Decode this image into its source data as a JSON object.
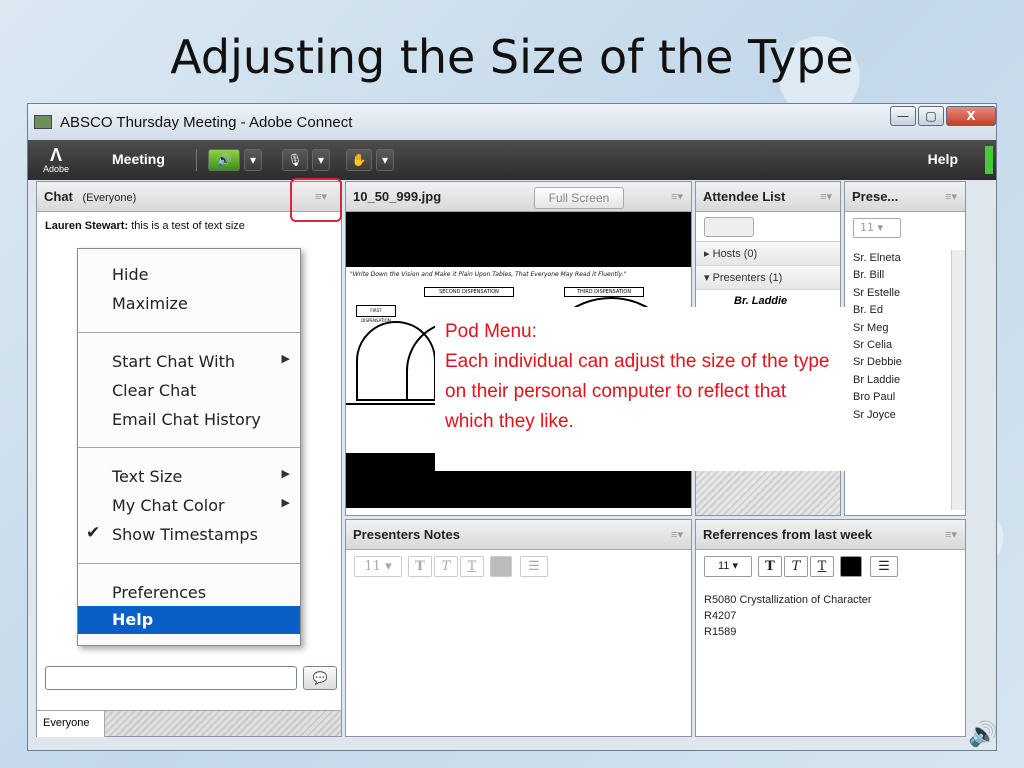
{
  "slide": {
    "title": "Adjusting the Size of the Type"
  },
  "window": {
    "title": "ABSCO Thursday Meeting - Adobe Connect",
    "buttons": {
      "minimize": "—",
      "maximize": "▢",
      "close": "X"
    }
  },
  "toolbar": {
    "logo_text": "Adobe",
    "meeting_menu": "Meeting",
    "help": "Help"
  },
  "chat": {
    "title": "Chat",
    "audience": "(Everyone)",
    "messages": [
      {
        "author": "Lauren Stewart:",
        "text": "this is a test of text size"
      }
    ],
    "footer_tab": "Everyone"
  },
  "context_menu": {
    "items": [
      {
        "label": "Hide"
      },
      {
        "label": "Maximize"
      },
      {
        "label": "Start Chat With",
        "submenu": true
      },
      {
        "label": "Clear Chat"
      },
      {
        "label": "Email Chat History"
      },
      {
        "label": "Text Size",
        "submenu": true
      },
      {
        "label": "My Chat Color",
        "submenu": true
      },
      {
        "label": "Show Timestamps",
        "checked": true
      },
      {
        "label": "Preferences"
      },
      {
        "label": "Help",
        "selected": true
      }
    ]
  },
  "share": {
    "title": "10_50_999.jpg",
    "full_screen": "Full Screen",
    "doc_caption": "\"Write Down the Vision and Make it Plain Upon Tables, That Everyone May Read it Fluently.\"",
    "doc_labels": [
      "SECOND DISPENSATION",
      "THIRD DISPENSATION",
      "FIRST DISPENSATION"
    ]
  },
  "attendees": {
    "title": "Attendee List",
    "groups": [
      {
        "label": "Hosts (0)",
        "expanded": false
      },
      {
        "label": "Presenters (1)",
        "expanded": true
      }
    ],
    "presenter": "Br. Laddie"
  },
  "presenters_pod": {
    "title": "Prese...",
    "font_size": "11",
    "names": [
      "Sr. Elneta",
      "Br. Bill",
      "Sr Estelle",
      "Br. Ed",
      "Sr Meg",
      "Sr Celia",
      "Sr Debbie",
      "Br Laddie",
      "Bro Paul",
      "Sr Joyce"
    ]
  },
  "notes": {
    "title": "Presenters Notes",
    "font_size": "11"
  },
  "references": {
    "title": "Referrences from last week",
    "font_size": "11",
    "lines": [
      "R5080 Crystallization of Character",
      "R4207",
      "R1589"
    ]
  },
  "callout": {
    "heading": "Pod Menu:",
    "body": "Each individual can adjust the size of the type on their personal computer to reflect that which they like."
  },
  "colors": {
    "highlight": "#d9263a",
    "callout_text": "#e5101a",
    "menu_selected": "#0a5fc7"
  },
  "icons": [
    "app-icon",
    "speaker-icon",
    "microphone-icon",
    "raise-hand-icon",
    "pod-menu-icon",
    "chat-send-icon",
    "list-view-icon",
    "sound-icon"
  ]
}
